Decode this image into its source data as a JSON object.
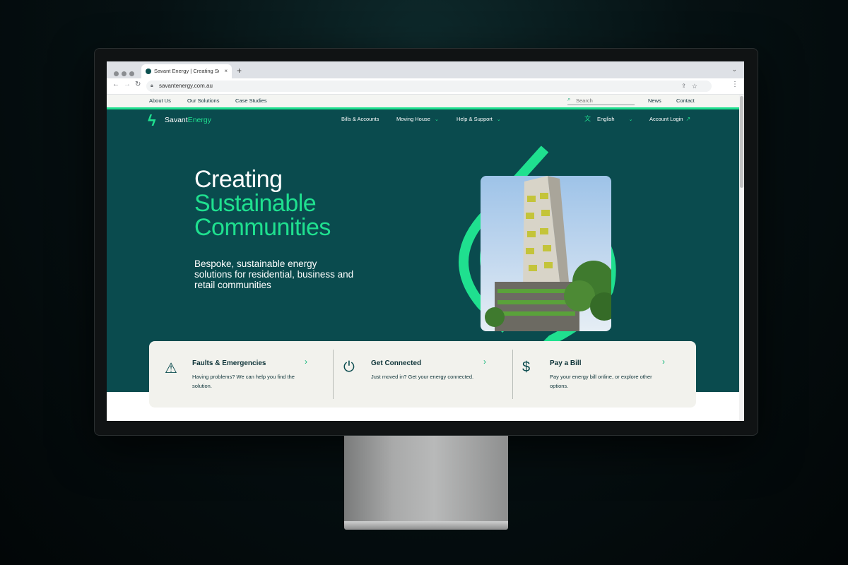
{
  "browser": {
    "tab_title": "Savant Energy | Creating Sust",
    "tab_close": "×",
    "new_tab": "+",
    "url": "savantenergy.com.au"
  },
  "util_nav": {
    "items": [
      "About Us",
      "Our Solutions",
      "Case Studies"
    ],
    "search_placeholder": "Search",
    "news": "News",
    "contact": "Contact"
  },
  "header": {
    "logo_savant": "Savant",
    "logo_energy": "Energy",
    "nav": [
      "Bills & Accounts",
      "Moving House",
      "Help & Support"
    ],
    "language": "English",
    "account_login": "Account Login"
  },
  "hero": {
    "line1": "Creating",
    "line2": "Sustainable",
    "line3": "Communities",
    "subtitle": "Bespoke, sustainable energy solutions for residential, business and retail communities"
  },
  "cards": [
    {
      "title": "Faults & Emergencies",
      "desc": "Having problems? We can help you find the solution.",
      "icon": "warning-icon"
    },
    {
      "title": "Get Connected",
      "desc": "Just moved in? Get your energy connected.",
      "icon": "plug-icon"
    },
    {
      "title": "Pay a Bill",
      "desc": "Pay your energy bill online, or explore other options.",
      "icon": "hand-dollar-icon"
    }
  ],
  "colors": {
    "brand_green": "#1fe08f",
    "hero_teal": "#0a4b4e",
    "card_bg": "#f2f2ed"
  }
}
